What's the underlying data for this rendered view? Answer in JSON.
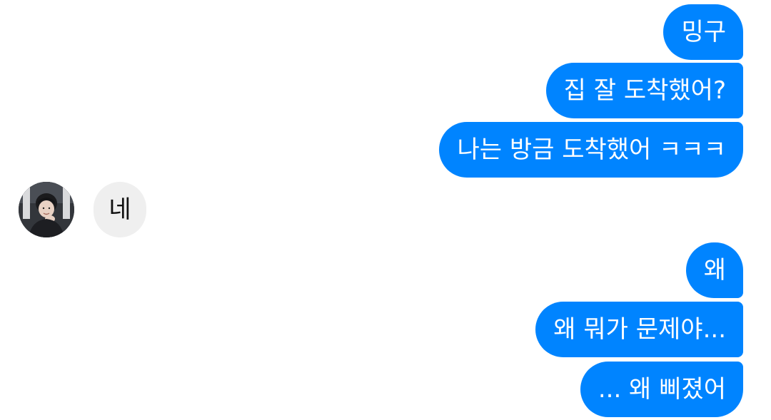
{
  "conversation": {
    "messages": [
      {
        "direction": "sent",
        "text": "밍구"
      },
      {
        "direction": "sent",
        "text": "집 잘 도착했어?"
      },
      {
        "direction": "sent",
        "text": "나는 방금 도착했어 ㅋㅋㅋ"
      },
      {
        "direction": "received",
        "text": "네"
      },
      {
        "direction": "sent",
        "text": "왜"
      },
      {
        "direction": "sent",
        "text": "왜 뭐가 문제야..."
      },
      {
        "direction": "sent",
        "text": "... 왜 삐졌어"
      }
    ],
    "contact": {
      "avatar_icon": "profile-photo-icon"
    }
  },
  "colors": {
    "sent_bubble": "#0084ff",
    "sent_text": "#ffffff",
    "received_bubble": "#efefef",
    "received_text": "#111111",
    "background": "#ffffff"
  }
}
